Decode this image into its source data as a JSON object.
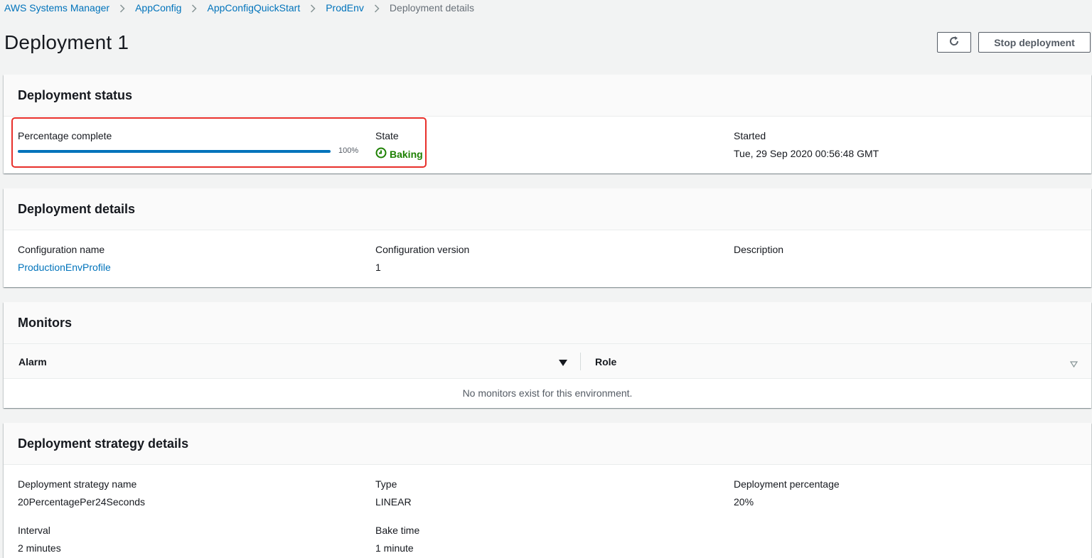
{
  "breadcrumb": {
    "items": [
      {
        "label": "AWS Systems Manager"
      },
      {
        "label": "AppConfig"
      },
      {
        "label": "AppConfigQuickStart"
      },
      {
        "label": "ProdEnv"
      }
    ],
    "current": "Deployment details"
  },
  "page": {
    "title": "Deployment 1",
    "refresh_icon": "refresh-icon",
    "stop_label": "Stop deployment"
  },
  "status_panel": {
    "title": "Deployment status",
    "percentage_label": "Percentage complete",
    "percentage_value": "100%",
    "progress_fraction": 1.0,
    "state_label": "State",
    "state_value": "Baking",
    "state_icon": "clock-icon",
    "state_color": "#1d8102",
    "started_label": "Started",
    "started_value": "Tue, 29 Sep 2020 00:56:48 GMT"
  },
  "details_panel": {
    "title": "Deployment details",
    "config_name_label": "Configuration name",
    "config_name_value": "ProductionEnvProfile",
    "config_version_label": "Configuration version",
    "config_version_value": "1",
    "description_label": "Description"
  },
  "monitors_panel": {
    "title": "Monitors",
    "columns": [
      {
        "label": "Alarm"
      },
      {
        "label": "Role"
      }
    ],
    "empty_text": "No monitors exist for this environment."
  },
  "strategy_panel": {
    "title": "Deployment strategy details",
    "name_label": "Deployment strategy name",
    "name_value": "20PercentagePer24Seconds",
    "type_label": "Type",
    "type_value": "LINEAR",
    "pct_label": "Deployment percentage",
    "pct_value": "20%",
    "interval_label": "Interval",
    "interval_value": "2 minutes",
    "bake_label": "Bake time",
    "bake_value": "1 minute"
  },
  "colors": {
    "link": "#0073bb",
    "highlight": "#e8302b",
    "success": "#1d8102"
  }
}
